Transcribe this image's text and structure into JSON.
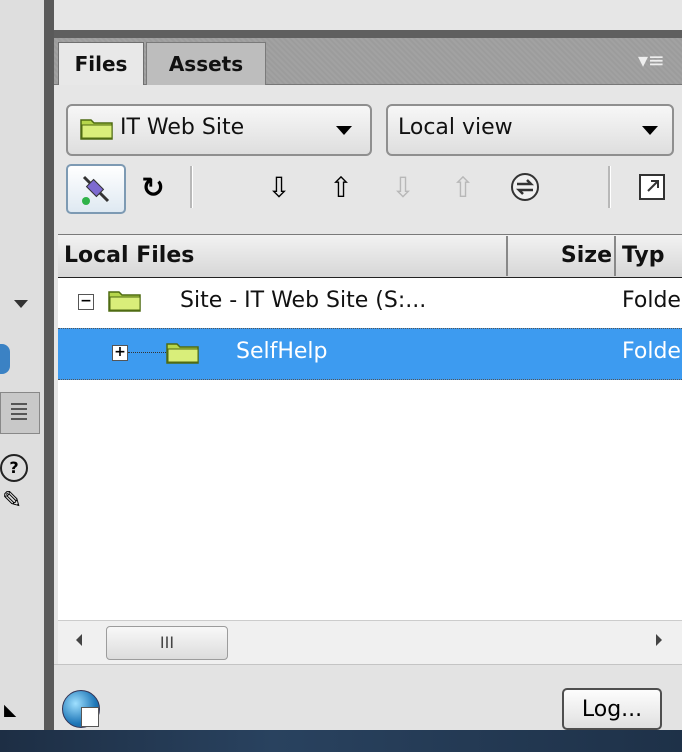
{
  "tabs": [
    {
      "label": "Files"
    },
    {
      "label": "Assets"
    }
  ],
  "panel_menu_icon": "panel-options-icon",
  "site_dropdown": {
    "value": "IT Web Site",
    "icon": "folder-icon"
  },
  "view_dropdown": {
    "value": "Local view"
  },
  "toolbar": {
    "icons": [
      "connect-icon",
      "refresh-icon",
      "get-files-icon",
      "put-files-icon",
      "check-out-icon",
      "check-in-icon",
      "synchronize-icon",
      "expand-icon"
    ]
  },
  "columns": {
    "name": "Local Files",
    "size": "Size",
    "type": "Typ"
  },
  "rows": [
    {
      "name": "Site - IT Web Site (S:...",
      "type": "Folde",
      "expander": "−",
      "selected": false
    },
    {
      "name": "SelfHelp",
      "type": "Folde",
      "expander": "+",
      "selected": true
    }
  ],
  "scroll_thumb_grip": "III",
  "log_button": "Log...",
  "colors": {
    "selection": "#3d9bf0",
    "tab_active": "#e8e8e8",
    "panel_bg": "#e6e6e6"
  }
}
